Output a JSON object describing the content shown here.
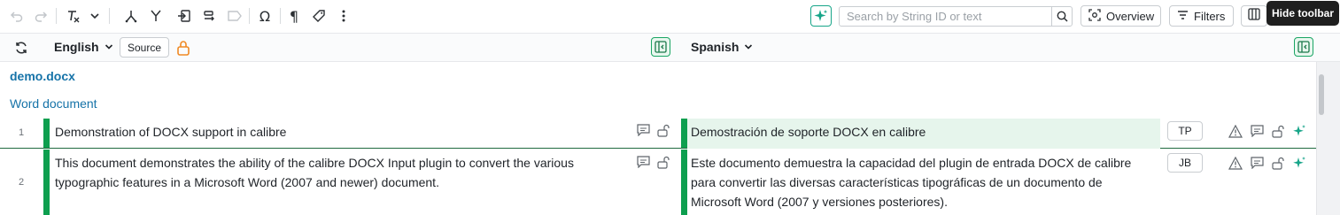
{
  "toolbar": {
    "tooltip": "Hide toolbar",
    "search_placeholder": "Search by String ID or text",
    "overview_label": "Overview",
    "filters_label": "Filters",
    "icons": [
      "undo-icon",
      "redo-icon",
      "clear-format-icon",
      "chevron-down-icon",
      "branch-icon",
      "merge-icon",
      "insert-icon",
      "split-icon",
      "tag-icon",
      "omega-icon",
      "pilcrow-icon",
      "label-icon",
      "more-icon",
      "sparkle-icon"
    ]
  },
  "header": {
    "source_language": "English",
    "source_button": "Source",
    "target_language": "Spanish"
  },
  "file": {
    "name": "demo.docx",
    "type": "Word document"
  },
  "rows": [
    {
      "number": "1",
      "source": "Demonstration of DOCX support in calibre",
      "target": "Demostración de soporte DOCX en calibre",
      "user": "TP"
    },
    {
      "number": "2",
      "source": "This document demonstrates the ability of the calibre DOCX Input plugin to convert the various typographic features in a Microsoft Word (2007 and newer) document.",
      "target": "Este documento demuestra la capacidad del plugin de entrada DOCX de calibre para convertir las diversas características tipográficas de un documento de Microsoft Word (2007 y versiones posteriores).",
      "user": "JB"
    }
  ],
  "colors": {
    "accent_green": "#0e9f4f",
    "link_blue": "#1673a8",
    "ai_teal": "#17a589",
    "lock_orange": "#f08a24",
    "translated_bg": "#e6f5ec"
  }
}
